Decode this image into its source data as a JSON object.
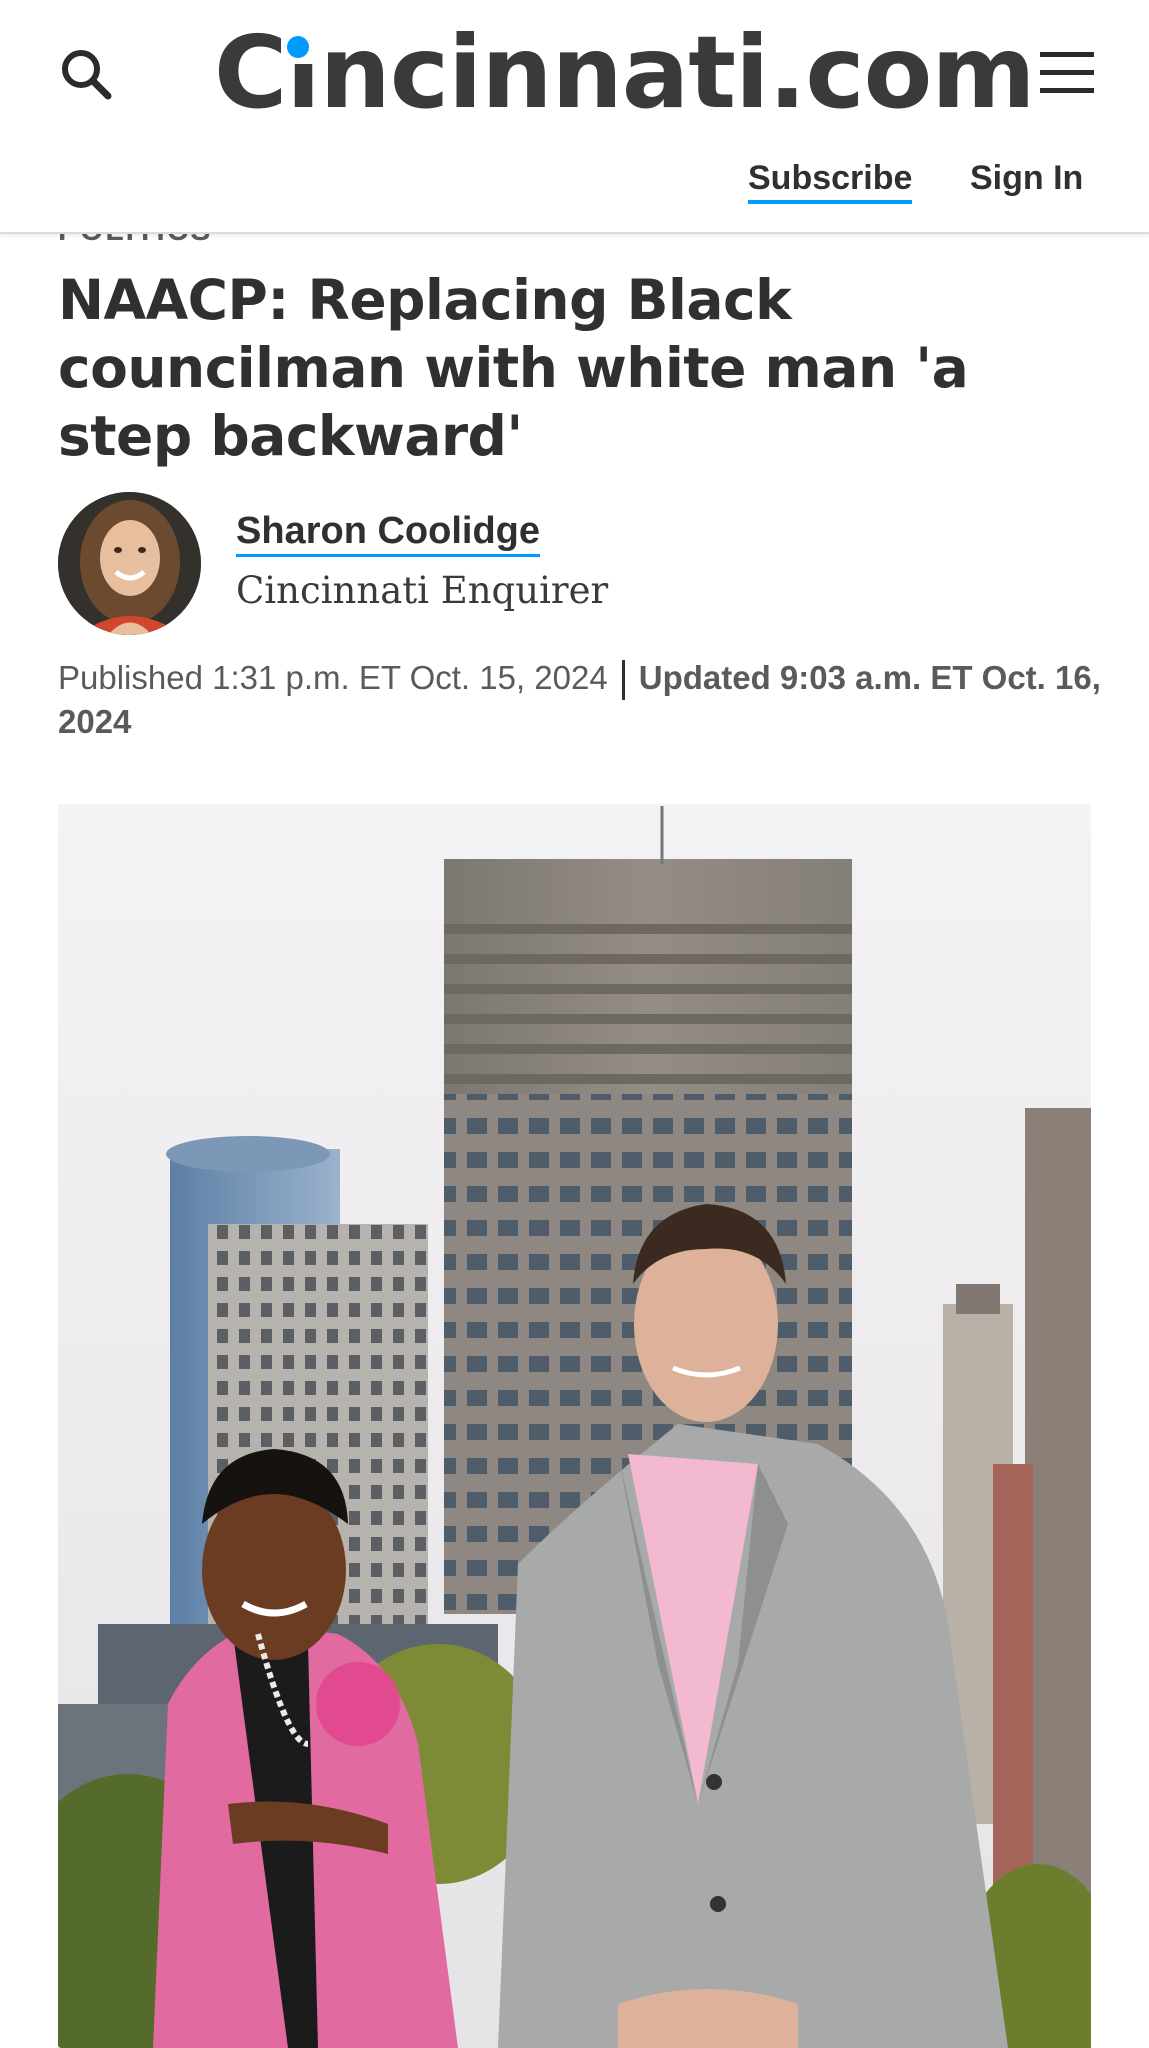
{
  "header": {
    "logo_text": "Cincinnati.com",
    "subscribe_label": "Subscribe",
    "signin_label": "Sign In",
    "accent_color": "#009bff"
  },
  "article": {
    "section": "POLITICS",
    "headline": "NAACP: Replacing Black councilman with white man 'a step backward'",
    "author": {
      "name": "Sharon Coolidge",
      "organization": "Cincinnati Enquirer"
    },
    "published": "Published 1:31 p.m. ET Oct. 15, 2024",
    "updated": "Updated 9:03 a.m. ET Oct. 16, 2024"
  },
  "icons": {
    "search": "search-icon",
    "menu": "hamburger-menu-icon"
  }
}
